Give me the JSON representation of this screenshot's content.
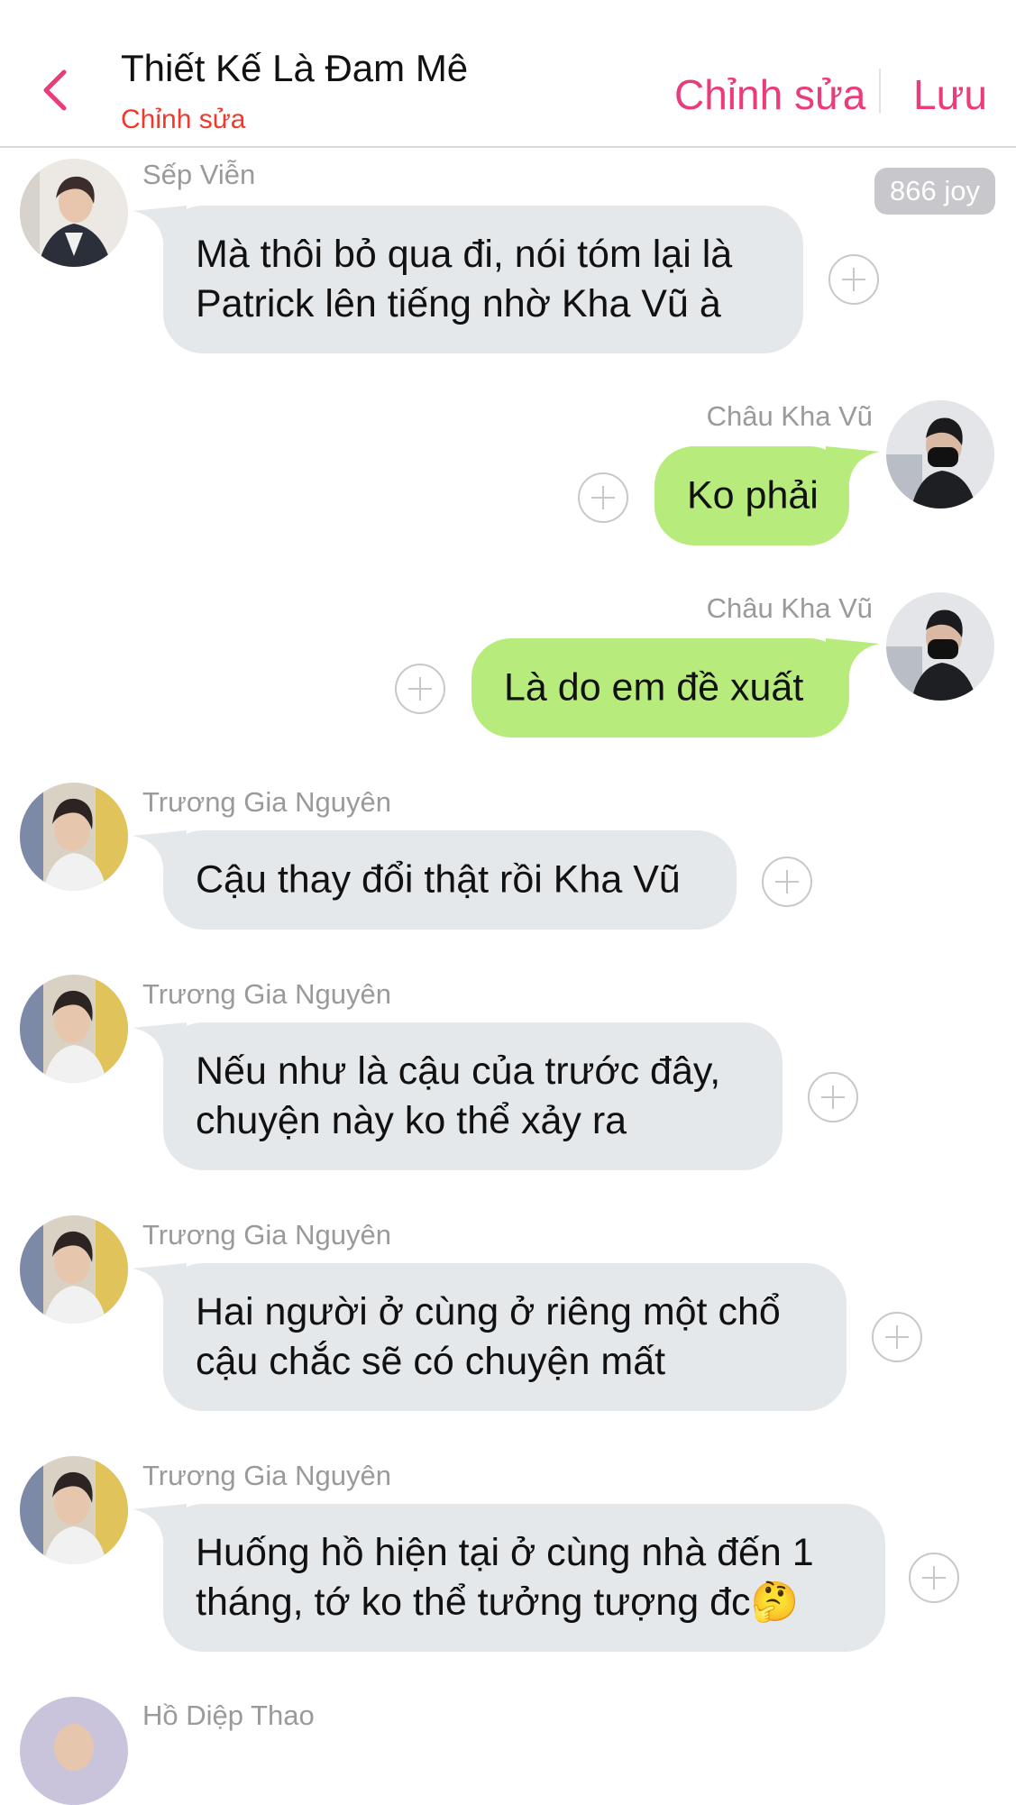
{
  "header": {
    "title": "Thiết Kế Là Đam Mê",
    "subtitle": "Chỉnh sửa",
    "edit_label": "Chỉnh sửa",
    "save_label": "Lưu"
  },
  "joy_badge": "866 joy",
  "messages": [
    {
      "sender": "Sếp Viễn",
      "text": "Mà thôi bỏ qua đi, nói tóm lại là\nPatrick lên tiếng nhờ Kha Vũ à",
      "direction": "incoming"
    },
    {
      "sender": "Châu Kha Vũ",
      "text": "Ko phải",
      "direction": "outgoing"
    },
    {
      "sender": "Châu Kha Vũ",
      "text": "Là do em đề xuất",
      "direction": "outgoing"
    },
    {
      "sender": "Trương Gia Nguyên",
      "text": "Cậu thay đổi thật rồi Kha Vũ",
      "direction": "incoming"
    },
    {
      "sender": "Trương Gia Nguyên",
      "text": "Nếu như là cậu của trước đây,\nchuyện này ko thể xảy ra",
      "direction": "incoming"
    },
    {
      "sender": "Trương Gia Nguyên",
      "text": "Hai người ở cùng ở riêng một chổ\ncậu chắc sẽ có chuyện mất",
      "direction": "incoming"
    },
    {
      "sender": "Trương Gia Nguyên",
      "text": "Huống hồ hiện tại ở cùng nhà đến 1\ntháng, tớ ko thể tưởng tượng đc🤔",
      "direction": "incoming"
    },
    {
      "sender": "Hồ Diệp Thao",
      "text": "",
      "direction": "incoming"
    }
  ],
  "colors": {
    "accent": "#ea3b7a",
    "subtitle": "#ec3a2b",
    "incoming_bubble": "#e5e8eb",
    "outgoing_bubble": "#b7ec7d"
  }
}
